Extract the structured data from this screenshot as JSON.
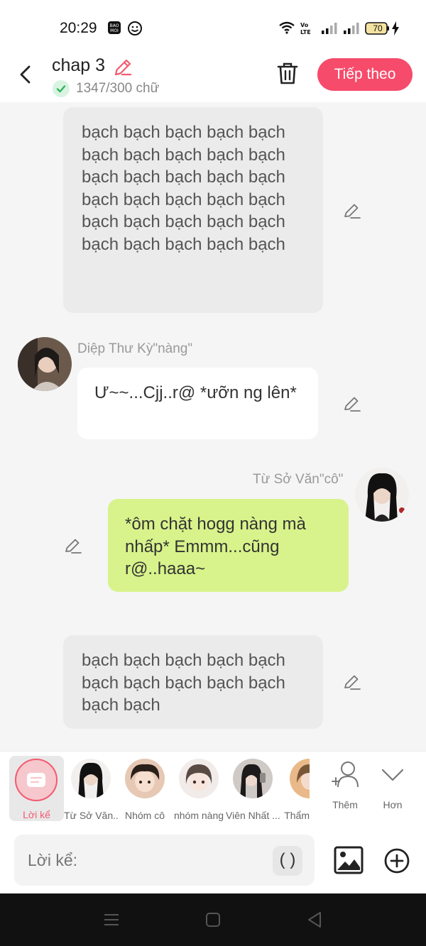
{
  "status_bar": {
    "time": "20:29",
    "battery": "70"
  },
  "header": {
    "title": "chap 3",
    "word_count": "1347/300 chữ",
    "next_label": "Tiếp theo"
  },
  "messages": [
    {
      "type": "narration",
      "text": "bạch bạch bạch bạch bạch bạch bạch bạch bạch bạch bạch bạch bạch bạch bạch bạch bạch bạch bạch bạch bạch bạch bạch bạch bạch bạch bạch bạch bạch bạch"
    },
    {
      "type": "left",
      "speaker": "Diệp Thư Kỳ\"nàng\"",
      "text": "Ư~~...Cjj..r@ *ưỡn ng lên*"
    },
    {
      "type": "right",
      "speaker": "Từ Sở Văn\"cô\"",
      "text": "*ôm chặt hogg nàng mà nhấp* Emmm...cũng r@..haaa~"
    },
    {
      "type": "narration",
      "text": "bạch bạch bạch bạch bạch bạch bạch bạch bạch bạch bạch bạch"
    }
  ],
  "character_bar": {
    "narrator_label": "Lời kể",
    "characters": [
      "Từ Sở Văn...",
      "Nhóm cô",
      "nhóm nàng",
      "Viên Nhất ...",
      "Thẩm"
    ],
    "more_label": "Thêm",
    "less_label": "Hơn"
  },
  "input": {
    "placeholder": "Lời kể:",
    "paren_label": "( )"
  },
  "colors": {
    "accent": "#f64b6b",
    "green_bubble": "#d8f38b",
    "gray_bubble": "#ebebeb"
  }
}
